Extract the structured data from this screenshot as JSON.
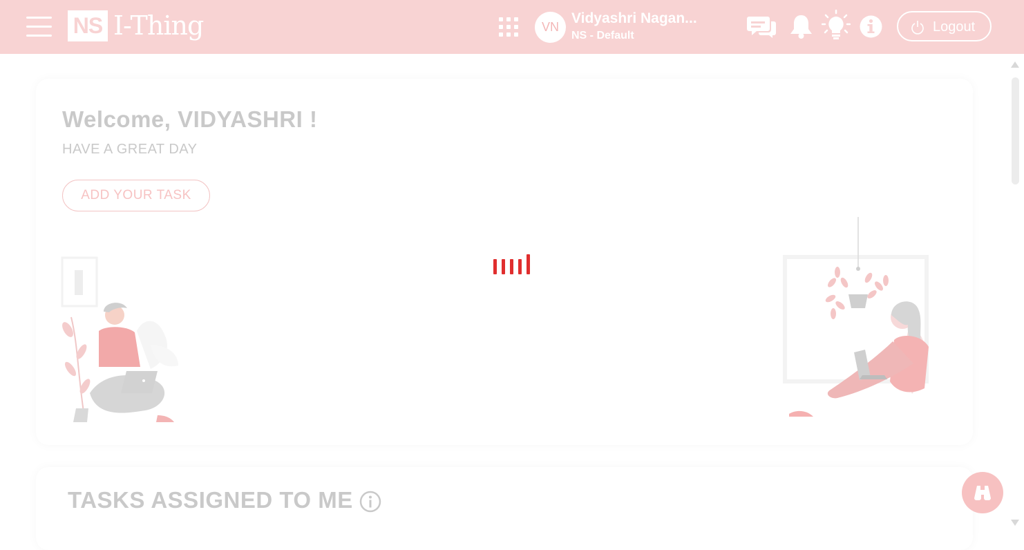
{
  "header": {
    "logo_abbr": "NS",
    "logo_text": "I-Thing",
    "user_initials": "VN",
    "user_name": "Vidyashri Nagan...",
    "user_org": "NS - Default",
    "logout_label": "Logout"
  },
  "welcome": {
    "title": "Welcome, VIDYASHRI !",
    "subtitle": "HAVE A GREAT DAY",
    "add_task_label": "ADD YOUR TASK"
  },
  "tasks": {
    "title": "TASKS ASSIGNED TO ME"
  },
  "colors": {
    "header_bg": "#f8d3d3",
    "accent": "#f3b7b7",
    "loader": "#e02e2e"
  }
}
